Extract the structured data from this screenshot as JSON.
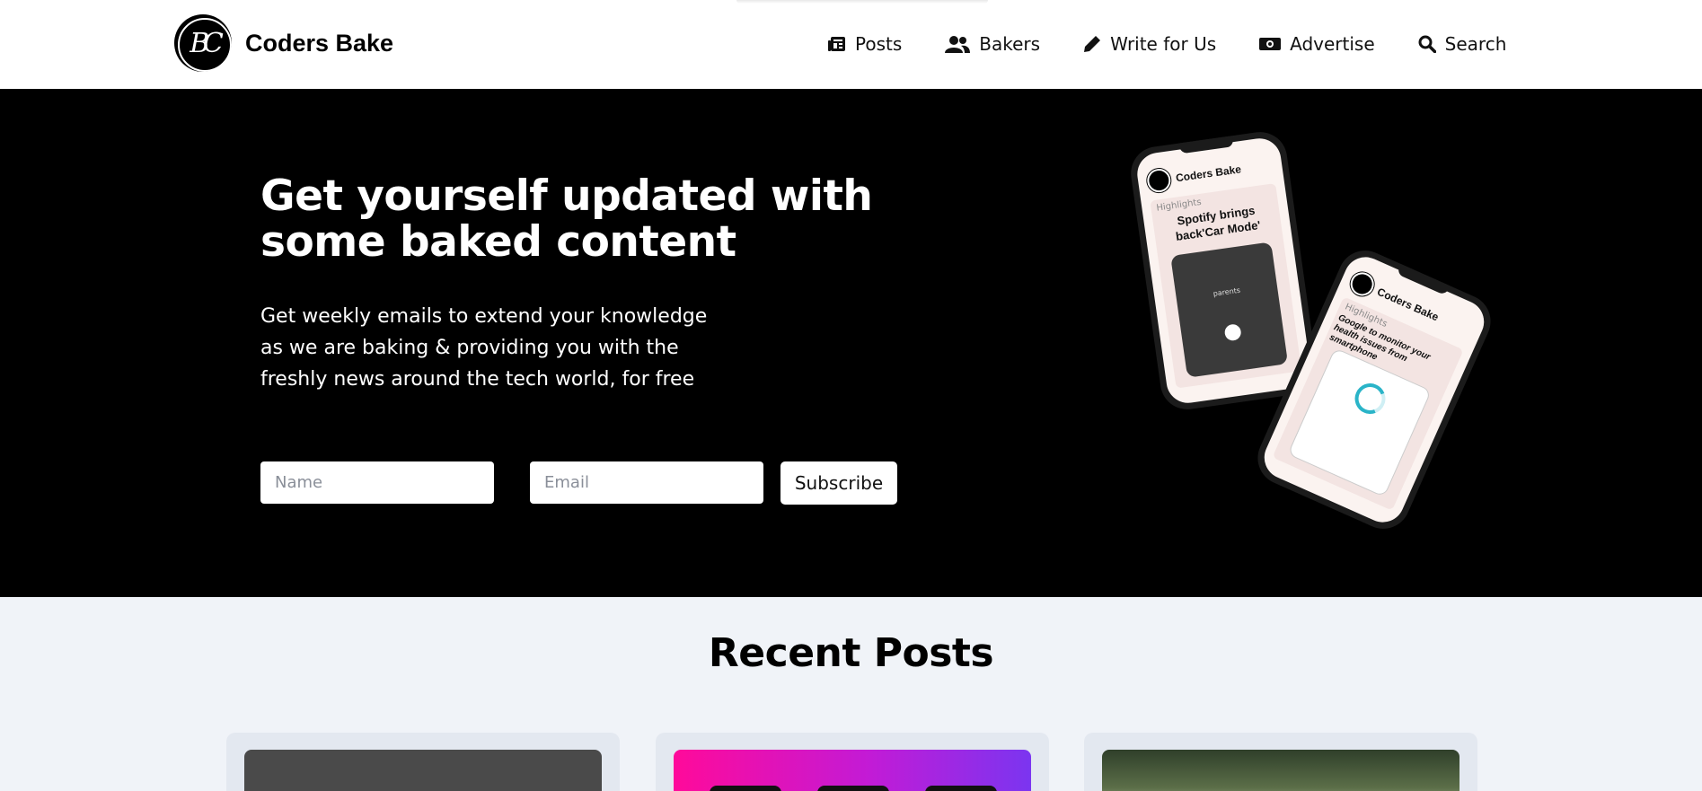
{
  "header": {
    "brand": "Coders Bake",
    "logo_text": "BC",
    "nav": [
      {
        "label": "Posts",
        "icon": "newspaper-icon"
      },
      {
        "label": "Bakers",
        "icon": "users-icon"
      },
      {
        "label": "Write for Us",
        "icon": "pencil-icon"
      },
      {
        "label": "Advertise",
        "icon": "money-bill-icon"
      },
      {
        "label": "Search",
        "icon": "search-icon"
      }
    ]
  },
  "hero": {
    "title": "Get yourself updated with some baked content",
    "subtitle": "Get weekly emails to extend your knowledge as we are baking & providing you with the freshly news around the tech world, for free",
    "name_placeholder": "Name",
    "email_placeholder": "Email",
    "subscribe_label": "Subscribe"
  },
  "phones": [
    {
      "brand": "Coders Bake",
      "section": "Highlights",
      "headline": "Spotify brings back'Car Mode'",
      "screen_text": "parents"
    },
    {
      "brand": "Coders Bake",
      "section": "Highlights",
      "headline": "Google to monitor your health issues from smartphone"
    }
  ],
  "recent": {
    "title": "Recent Posts"
  },
  "colors": {
    "hero_bg": "#000000",
    "page_bg": "#f0f3f8",
    "card_bg": "#e3e8f0",
    "accent_gradient_start": "#ff0a9a",
    "accent_gradient_end": "#7b35f0"
  }
}
